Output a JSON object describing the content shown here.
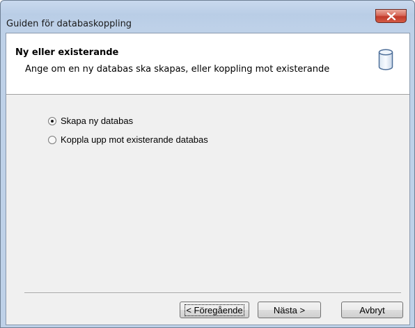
{
  "window": {
    "title": "Guiden för databaskoppling",
    "close_glyph": "✕"
  },
  "header": {
    "title": "Ny eller existerande",
    "subtitle": "Ange om en ny databas ska skapas, eller koppling mot existerande",
    "icon": "database-icon"
  },
  "options": [
    {
      "label": "Skapa ny databas",
      "selected": true
    },
    {
      "label": "Koppla upp mot existerande databas",
      "selected": false
    }
  ],
  "buttons": {
    "back_label": "< Föregående",
    "next_label": "Nästa >",
    "cancel_label": "Avbryt"
  }
}
